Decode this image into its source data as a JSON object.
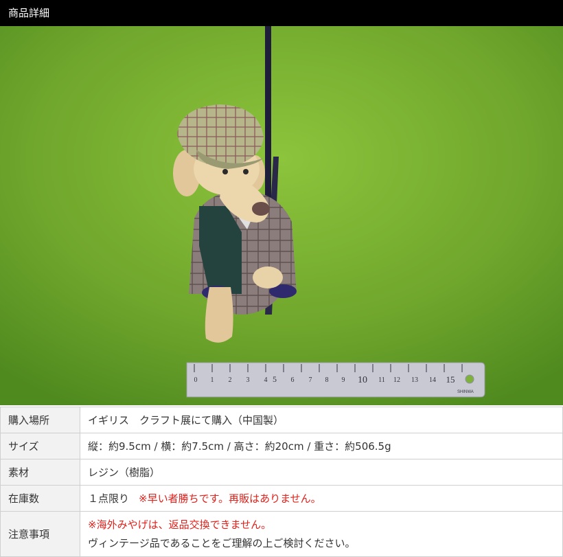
{
  "header": {
    "title": "商品詳細"
  },
  "photo": {
    "ruler_marks": [
      "0",
      "1",
      "2",
      "3",
      "4",
      "5",
      "6",
      "7",
      "8",
      "9",
      "10",
      "11",
      "12",
      "13",
      "14",
      "15"
    ],
    "ruler_maker": "SHINWA",
    "colors": {
      "grass": "#6fa62c",
      "grass_dark": "#4f8a1f"
    }
  },
  "specs": {
    "purchase": {
      "label": "購入場所",
      "value": "イギリス　クラフト展にて購入（中国製）"
    },
    "size": {
      "label": "サイズ",
      "value": "縦：約9.5cm / 横：約7.5cm / 高さ：約20cm / 重さ：約506.5g"
    },
    "material": {
      "label": "素材",
      "value": "レジン（樹脂）"
    },
    "stock": {
      "label": "在庫数",
      "value": "１点限り",
      "note": "※早い者勝ちです。再販はありません。"
    },
    "notice": {
      "label": "注意事項",
      "line1": "※海外みやげは、返品交換できません。",
      "line2": "ヴィンテージ品であることをご理解の上ご検討ください。"
    }
  }
}
